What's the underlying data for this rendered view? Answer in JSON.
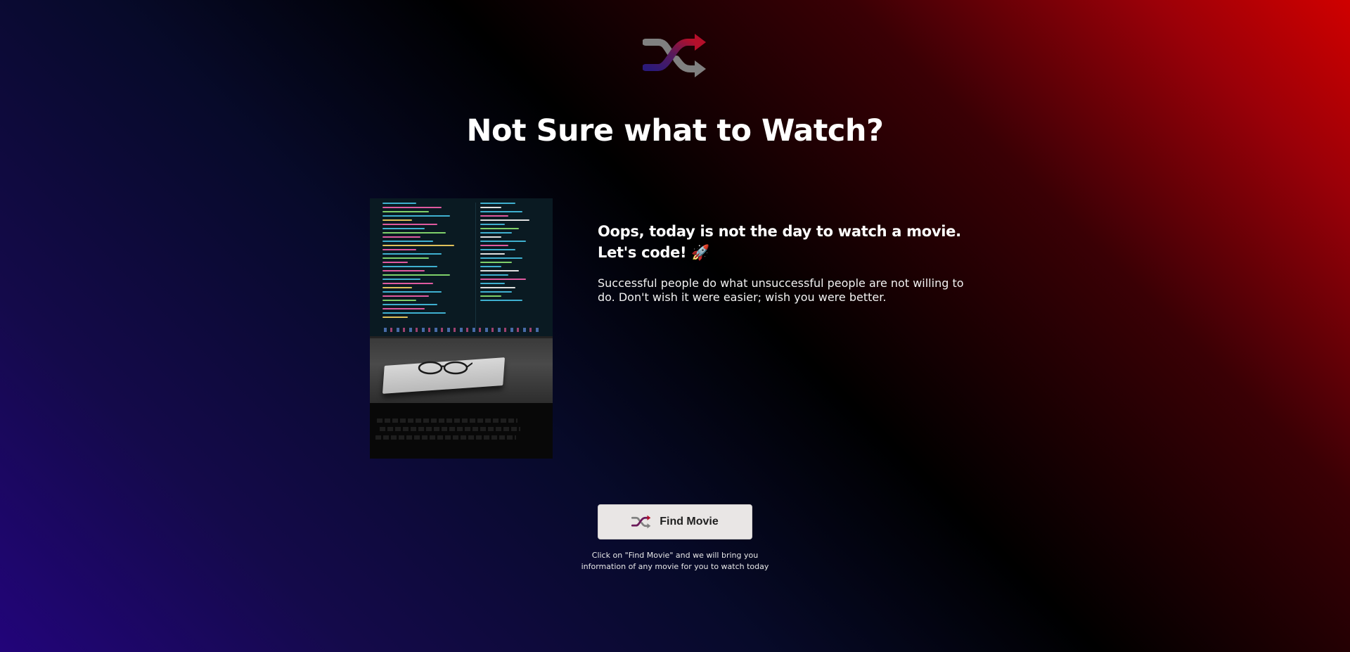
{
  "logo": {
    "icon": "shuffle-icon"
  },
  "headline": "Not Sure what to Watch?",
  "result": {
    "image_alt": "Desk with laptop showing code, glasses and notebook",
    "title": "Oops, today is not the day to watch a movie. Let's code! 🚀",
    "description": "Successful people do what unsuccessful people are not willing to do. Don't wish it were easier; wish you were better."
  },
  "action": {
    "button_label": "Find Movie",
    "button_icon": "shuffle-icon",
    "hint": "Click on \"Find Movie\" and we will bring you information of any movie for you to watch today"
  },
  "colors": {
    "accent_red": "#c8102e",
    "accent_purple": "#3a1a8a",
    "button_bg": "#e9e6e5"
  }
}
